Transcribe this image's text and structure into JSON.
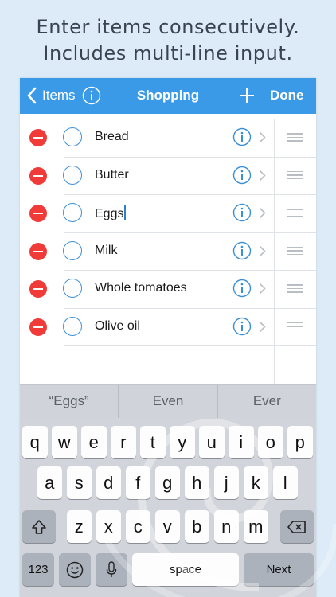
{
  "caption": {
    "line1": "Enter items consecutively.",
    "line2": "Includes multi-line input."
  },
  "navbar": {
    "back_label": "Items",
    "title": "Shopping",
    "done_label": "Done",
    "color": "#3b9ae8"
  },
  "items": [
    {
      "label": "Bread"
    },
    {
      "label": "Butter"
    },
    {
      "label": "Eggs",
      "editing": true
    },
    {
      "label": "Milk"
    },
    {
      "label": "Whole tomatoes"
    },
    {
      "label": "Olive oil"
    }
  ],
  "suggestions": [
    "“Eggs”",
    "Even",
    "Ever"
  ],
  "keyboard": {
    "row1": [
      "q",
      "w",
      "e",
      "r",
      "t",
      "y",
      "u",
      "i",
      "o",
      "p"
    ],
    "row2": [
      "a",
      "s",
      "d",
      "f",
      "g",
      "h",
      "j",
      "k",
      "l"
    ],
    "row3": [
      "z",
      "x",
      "c",
      "v",
      "b",
      "n",
      "m"
    ],
    "numbers_label": "123",
    "space_label": "space",
    "next_label": "Next"
  },
  "colors": {
    "delete": "#f03b38",
    "accent": "#3b8fd6"
  }
}
